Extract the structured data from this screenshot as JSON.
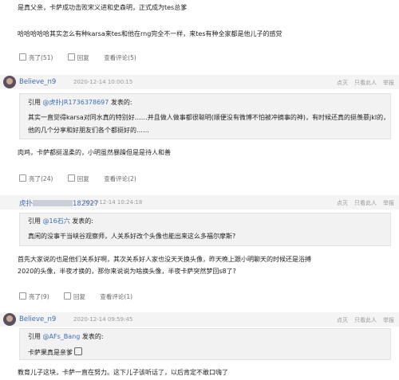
{
  "top": {
    "line1": "是真父亲，卡萨成功击败宋义进和史森明，正式成为tes总爹",
    "line2": "哈哈哈哈哈其实怎么有种karsa来tes和他在rng完全不一样，来tes有种全家都是他儿子的感觉",
    "actions": {
      "like": "亮了(51)",
      "reply": "回复",
      "view": "查看评论(5)"
    }
  },
  "c1": {
    "user": "Believe_n9",
    "time": "2020-12-14 10:00:15",
    "ops": [
      "点灭",
      "只看此人",
      "举报"
    ],
    "quote_prefix": "引用",
    "quote_user": "@虎扑JR1736378697",
    "quote_suffix": "发表的:",
    "quote_l1": "其实一直觉得karsa对同水真的特别好……并且做人做事都很聪明(顺便没有微博不怕被冲摘事的神)，有时候还真的挺羡慕jkl的，",
    "quote_l2": "他的几个分享和好朋友们各个都挺好的……",
    "body": "肉鸡，卡萨都挺温柔的，小明虽然暴躁但是是待人和善",
    "actions": {
      "like": "亮了(24)",
      "reply": "回复",
      "view": "查看评论(2)"
    }
  },
  "c2": {
    "user_prefix": "虎扑",
    "user_suffix": "182927",
    "time": "2020-12-14 10:24:18",
    "ops": [
      "点灭",
      "只看此人",
      "举报"
    ],
    "quote_prefix": "引用",
    "quote_user": "@16石六",
    "quote_suffix": "发表的:",
    "quote_l1": "真闲的没事干当峡谷观察师，人关系好改个头像也能出来这么多福尔摩斯?",
    "body_l1": "首先大家说的也是他们关系好啊，其次关系好人家也没天天换头像，昨天晚上跟小明聊天的时候还是浴搏",
    "body_l2": "2020的头像，半夜才换的，那你来说说为啥换头像，半夜卡萨突然梦回s8了?",
    "actions": {
      "like": "亮了(9)",
      "reply": "回复",
      "view": "查看评论(1)"
    }
  },
  "c3": {
    "user": "Believe_n9",
    "time": "2020-12-14 09:59:45",
    "ops": [
      "点灭",
      "只看此人",
      "举报"
    ],
    "quote_prefix": "引用",
    "quote_user": "@AFs_Bang",
    "quote_suffix": "发表的:",
    "quote_l1": "卡萨果真是亲爹",
    "body": "教育儿子这块，卡萨一直在努力。这下儿子该听话了，以后肯定不敢口嗨了"
  }
}
